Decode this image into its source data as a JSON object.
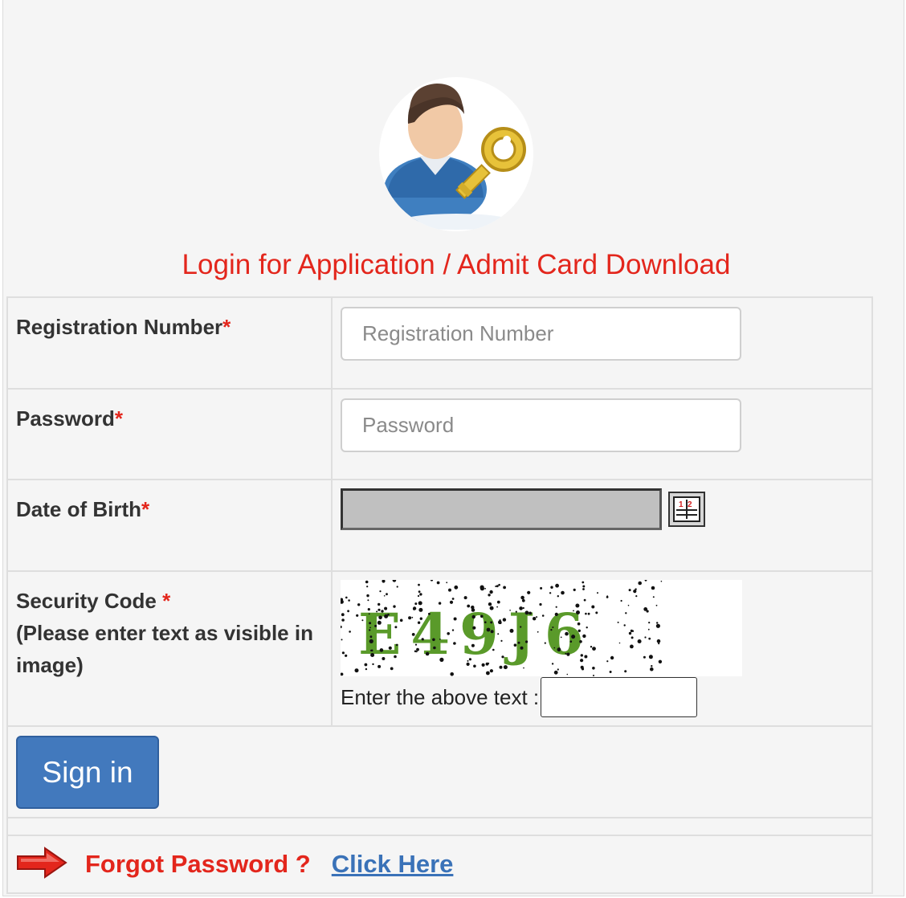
{
  "page": {
    "title": "Login for Application / Admit Card Download"
  },
  "form": {
    "registration": {
      "label": "Registration Number",
      "required_mark": "*",
      "placeholder": "Registration Number",
      "value": ""
    },
    "password": {
      "label": "Password",
      "required_mark": "*",
      "placeholder": "Password",
      "value": ""
    },
    "dob": {
      "label": "Date of Birth",
      "required_mark": "*",
      "value": ""
    },
    "security": {
      "label": "Security Code ",
      "required_mark": "*",
      "hint": "(Please enter text as visible in image)",
      "captcha_text": "E49J6",
      "enter_label": "Enter the above text :",
      "value": ""
    },
    "signin_label": "Sign in"
  },
  "footer": {
    "forgot_text": "Forgot Password ?",
    "link_text": "Click Here"
  },
  "colors": {
    "accent_red": "#e3261c",
    "button_blue": "#4279bd",
    "link_blue": "#3a72b8",
    "captcha_green": "#5a9a2a"
  },
  "icons": {
    "avatar": "user-key-icon",
    "calendar": "calendar-icon",
    "arrow": "red-arrow-icon"
  }
}
